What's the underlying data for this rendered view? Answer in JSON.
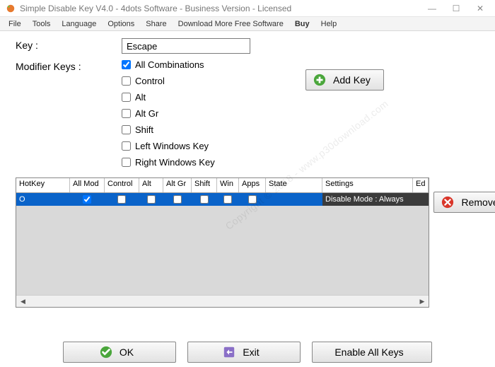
{
  "title": "Simple Disable Key V4.0 - 4dots Software - Business Version - Licensed",
  "menu": {
    "file": "File",
    "tools": "Tools",
    "language": "Language",
    "options": "Options",
    "share": "Share",
    "download": "Download More Free Software",
    "buy": "Buy",
    "help": "Help"
  },
  "labels": {
    "key": "Key :",
    "modifiers": "Modifier Keys :"
  },
  "key_input": "Escape",
  "mods": {
    "all": "All Combinations",
    "ctrl": "Control",
    "alt": "Alt",
    "altgr": "Alt Gr",
    "shift": "Shift",
    "lwin": "Left Windows Key",
    "rwin": "Right Windows Key",
    "all_checked": true,
    "ctrl_checked": false,
    "alt_checked": false,
    "altgr_checked": false,
    "shift_checked": false,
    "lwin_checked": false,
    "rwin_checked": false
  },
  "buttons": {
    "addkey": "Add Key",
    "remove": "Remove",
    "ok": "OK",
    "exit": "Exit",
    "enable": "Enable All Keys"
  },
  "grid": {
    "headers": {
      "hotkey": "HotKey",
      "allmod": "All Mod",
      "control": "Control",
      "alt": "Alt",
      "altgr": "Alt Gr",
      "shift": "Shift",
      "win": "Win",
      "apps": "Apps",
      "state": "State",
      "settings": "Settings",
      "edit": "Ed"
    },
    "row": {
      "hotkey": "O",
      "allmod": true,
      "control": false,
      "alt": false,
      "altgr": false,
      "shift": false,
      "win": false,
      "apps": false,
      "state": "",
      "settings": "Disable Mode : Always"
    }
  },
  "watermark": "Copyright © 2018 - www.p30download.com"
}
